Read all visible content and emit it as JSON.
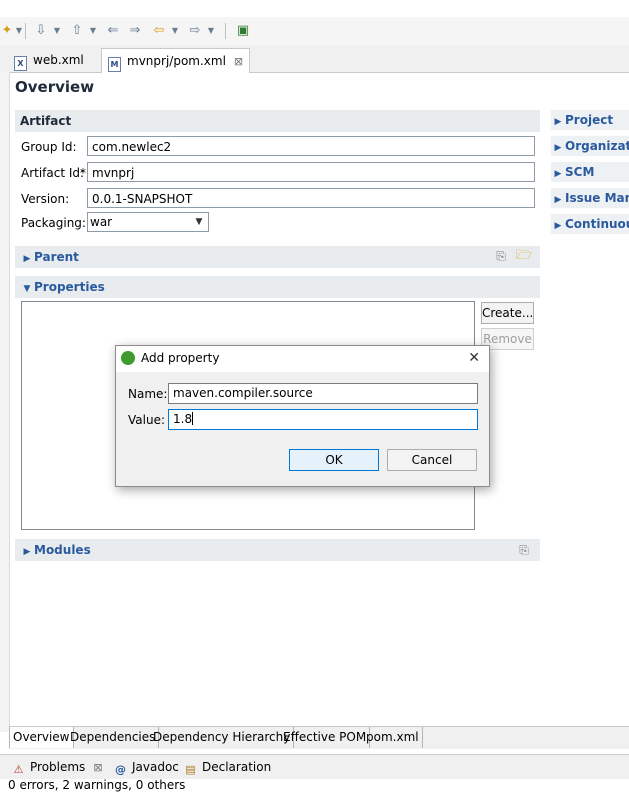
{
  "editor_tabs": [
    {
      "label": "web.xml",
      "icon": "xml-file-icon"
    },
    {
      "label": "mvnprj/pom.xml",
      "icon": "maven-file-icon",
      "close": "⊠"
    }
  ],
  "overview": {
    "title": "Overview",
    "artifact": {
      "header": "Artifact",
      "group_id_label": "Group Id:",
      "group_id_value": "com.newlec2",
      "artifact_id_label": "Artifact Id:",
      "required_marker": "*",
      "artifact_id_value": "mvnprj",
      "version_label": "Version:",
      "version_value": "0.0.1-SNAPSHOT",
      "packaging_label": "Packaging:",
      "packaging_value": "war"
    },
    "parent_header": "Parent",
    "properties_header": "Properties",
    "create_button": "Create...",
    "remove_button": "Remove",
    "modules_header": "Modules"
  },
  "right_sections": [
    "Project",
    "Organization",
    "SCM",
    "Issue Management",
    "Continuous Integration"
  ],
  "dialog": {
    "title": "Add property",
    "name_label": "Name:",
    "name_value": "maven.compiler.source",
    "value_label": "Value:",
    "value_value": "1.8",
    "ok_button": "OK",
    "cancel_button": "Cancel"
  },
  "page_tabs": [
    "Overview",
    "Dependencies",
    "Dependency Hierarchy",
    "Effective POM",
    "pom.xml"
  ],
  "view_tabs": {
    "problems": "Problems",
    "problems_close": "⊠",
    "javadoc_symbol": "@",
    "javadoc": "Javadoc",
    "declaration": "Declaration"
  },
  "status": "0 errors, 2 warnings, 0 others",
  "colors": {
    "accent": "#2a5a9e",
    "focus": "#0078d7",
    "maven_green": "#3f9b2c"
  }
}
